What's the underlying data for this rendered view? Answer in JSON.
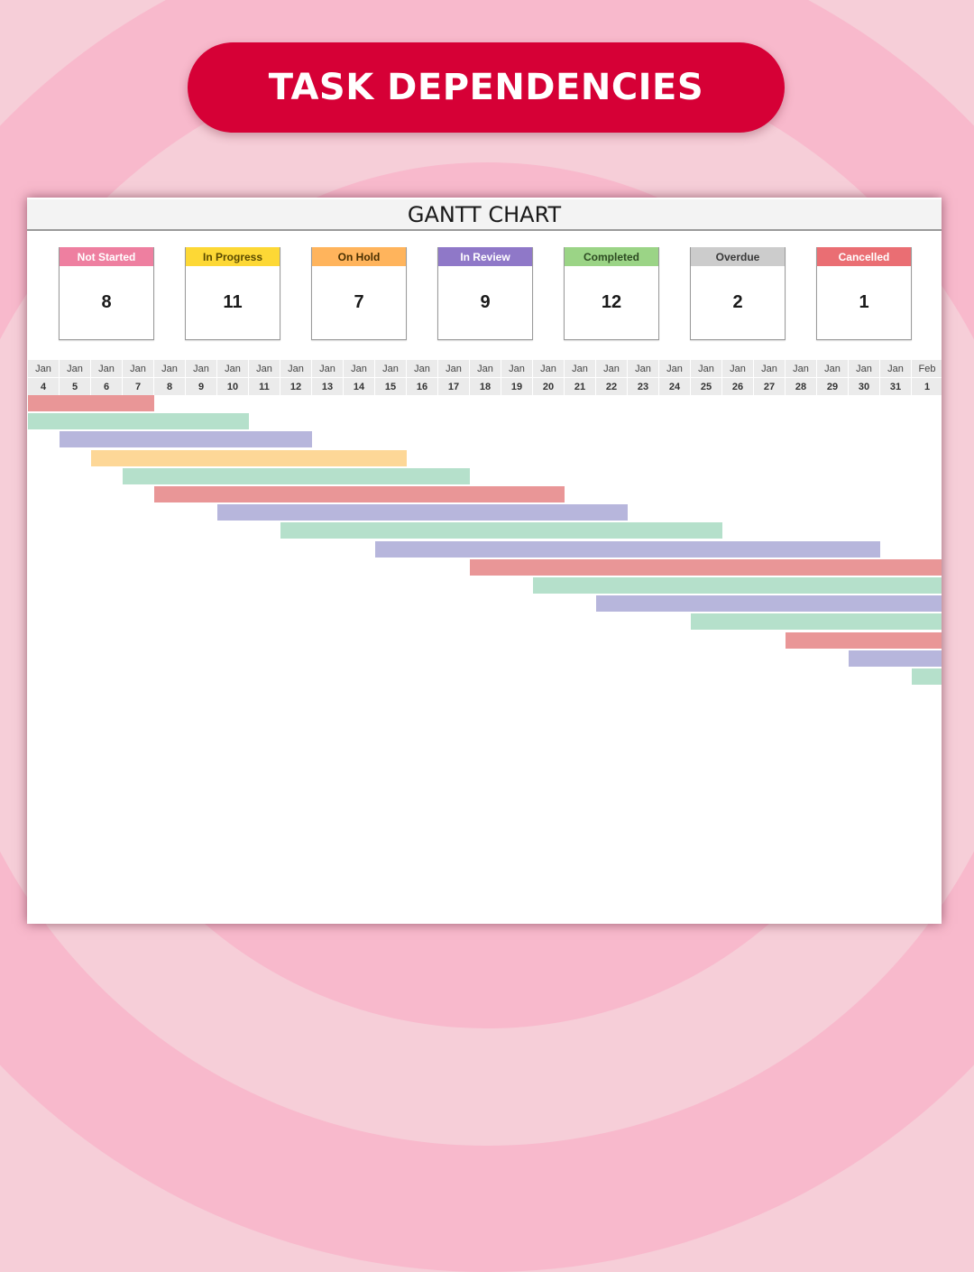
{
  "banner": {
    "title": "TASK DEPENDENCIES"
  },
  "card": {
    "title": "GANTT CHART"
  },
  "status_summary": [
    {
      "label": "Not Started",
      "count": "8",
      "color": "#ee7fa0",
      "text_color": "#ffffff"
    },
    {
      "label": "In Progress",
      "count": "11",
      "color": "#fdd835",
      "text_color": "#5a4a00"
    },
    {
      "label": "On Hold",
      "count": "7",
      "color": "#ffb45c",
      "text_color": "#4a3000"
    },
    {
      "label": "In Review",
      "count": "9",
      "color": "#8f78c8",
      "text_color": "#ffffff"
    },
    {
      "label": "Completed",
      "count": "12",
      "color": "#9bd486",
      "text_color": "#2d4a22"
    },
    {
      "label": "Overdue",
      "count": "2",
      "color": "#cccccc",
      "text_color": "#3a3a3a"
    },
    {
      "label": "Cancelled",
      "count": "1",
      "color": "#ea6e73",
      "text_color": "#ffffff"
    }
  ],
  "chart_data": {
    "type": "gantt",
    "title": "GANTT CHART",
    "dates": [
      {
        "month": "Jan",
        "day": "4"
      },
      {
        "month": "Jan",
        "day": "5"
      },
      {
        "month": "Jan",
        "day": "6"
      },
      {
        "month": "Jan",
        "day": "7"
      },
      {
        "month": "Jan",
        "day": "8"
      },
      {
        "month": "Jan",
        "day": "9"
      },
      {
        "month": "Jan",
        "day": "10"
      },
      {
        "month": "Jan",
        "day": "11"
      },
      {
        "month": "Jan",
        "day": "12"
      },
      {
        "month": "Jan",
        "day": "13"
      },
      {
        "month": "Jan",
        "day": "14"
      },
      {
        "month": "Jan",
        "day": "15"
      },
      {
        "month": "Jan",
        "day": "16"
      },
      {
        "month": "Jan",
        "day": "17"
      },
      {
        "month": "Jan",
        "day": "18"
      },
      {
        "month": "Jan",
        "day": "19"
      },
      {
        "month": "Jan",
        "day": "20"
      },
      {
        "month": "Jan",
        "day": "21"
      },
      {
        "month": "Jan",
        "day": "22"
      },
      {
        "month": "Jan",
        "day": "23"
      },
      {
        "month": "Jan",
        "day": "24"
      },
      {
        "month": "Jan",
        "day": "25"
      },
      {
        "month": "Jan",
        "day": "26"
      },
      {
        "month": "Jan",
        "day": "27"
      },
      {
        "month": "Jan",
        "day": "28"
      },
      {
        "month": "Jan",
        "day": "29"
      },
      {
        "month": "Jan",
        "day": "30"
      },
      {
        "month": "Jan",
        "day": "31"
      },
      {
        "month": "Feb",
        "day": "1"
      }
    ],
    "bar_colors": {
      "red": "#e99697",
      "green": "#b5e0cb",
      "purple": "#b7b6dc",
      "orange": "#fdd797"
    },
    "tasks": [
      {
        "start_index": 0,
        "duration_days": 4,
        "color": "red"
      },
      {
        "start_index": 0,
        "duration_days": 7,
        "color": "green"
      },
      {
        "start_index": 1,
        "duration_days": 8,
        "color": "purple"
      },
      {
        "start_index": 2,
        "duration_days": 10,
        "color": "orange"
      },
      {
        "start_index": 3,
        "duration_days": 11,
        "color": "green"
      },
      {
        "start_index": 4,
        "duration_days": 13,
        "color": "red"
      },
      {
        "start_index": 6,
        "duration_days": 13,
        "color": "purple"
      },
      {
        "start_index": 8,
        "duration_days": 14,
        "color": "green"
      },
      {
        "start_index": 11,
        "duration_days": 16,
        "color": "purple"
      },
      {
        "start_index": 14,
        "duration_days": 15,
        "color": "red"
      },
      {
        "start_index": 16,
        "duration_days": 13,
        "color": "green"
      },
      {
        "start_index": 18,
        "duration_days": 11,
        "color": "purple"
      },
      {
        "start_index": 21,
        "duration_days": 8,
        "color": "green"
      },
      {
        "start_index": 24,
        "duration_days": 5,
        "color": "red"
      },
      {
        "start_index": 26,
        "duration_days": 3,
        "color": "purple"
      },
      {
        "start_index": 28,
        "duration_days": 1,
        "color": "green"
      }
    ]
  }
}
